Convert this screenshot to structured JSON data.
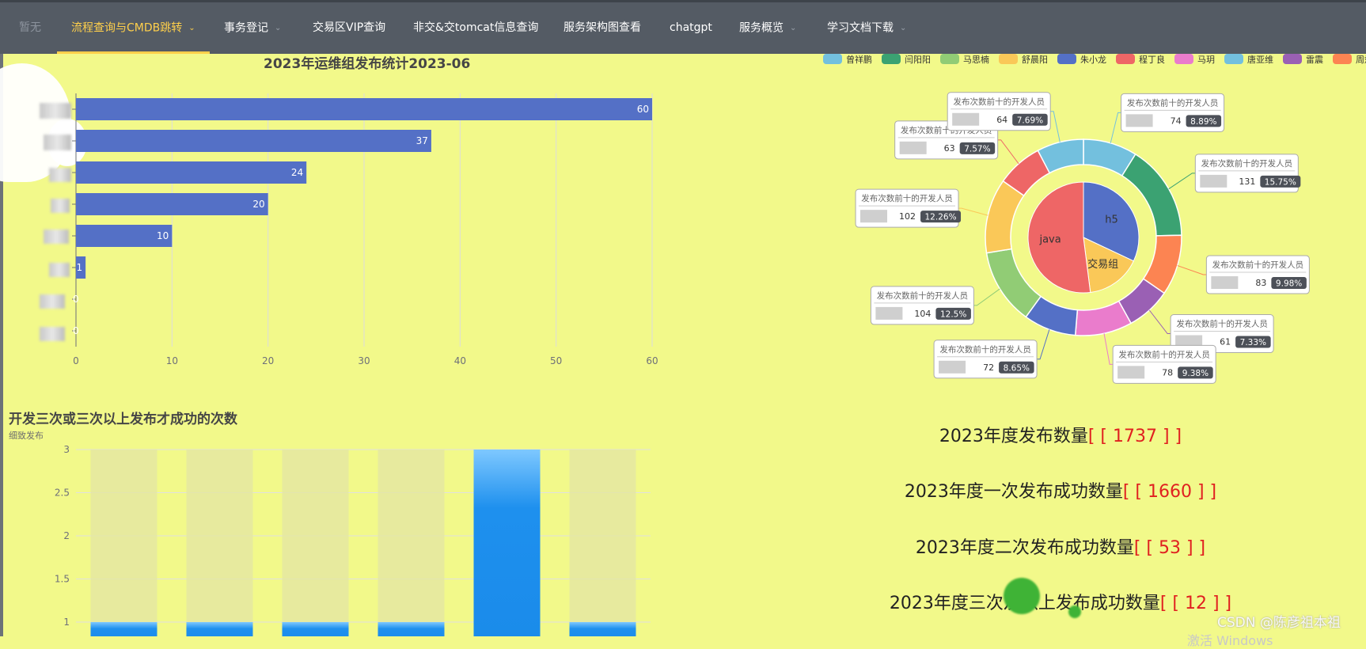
{
  "nav": {
    "items": [
      {
        "label": "暂无",
        "dropdown": false,
        "state": "disabled"
      },
      {
        "label": "流程查询与CMDB跳转",
        "dropdown": true,
        "state": "active"
      },
      {
        "label": "事务登记",
        "dropdown": true,
        "state": "normal"
      },
      {
        "label": "交易区VIP查询",
        "dropdown": false,
        "state": "normal"
      },
      {
        "label": "非交&交tomcat信息查询",
        "dropdown": false,
        "state": "normal"
      },
      {
        "label": "服务架构图查看",
        "dropdown": false,
        "state": "normal"
      },
      {
        "label": "chatgpt",
        "dropdown": false,
        "state": "normal"
      },
      {
        "label": "服务概览",
        "dropdown": true,
        "state": "normal"
      },
      {
        "label": "学习文档下载",
        "dropdown": true,
        "state": "normal"
      }
    ],
    "colors": {
      "background": "#545b64",
      "active": "#ffd04b",
      "text": "#ffffff",
      "disabled": "#8c939d"
    }
  },
  "chart_data": [
    {
      "type": "bar",
      "orientation": "horizontal",
      "title": "2023年运维组发布统计2023-06",
      "values": [
        60,
        37,
        24,
        20,
        10,
        1,
        0,
        0
      ],
      "value_labels": [
        "60",
        "37",
        "24",
        "20",
        "10",
        "1",
        "0",
        "0"
      ],
      "xlim": [
        0,
        60
      ],
      "x_ticks": [
        "0",
        "10",
        "20",
        "30",
        "40",
        "50",
        "60"
      ],
      "category_labels_obscured": true,
      "grid": true,
      "color": "#5470c6"
    },
    {
      "type": "pie",
      "variant": "nested-donut",
      "legend": [
        "曾祥鹏",
        "闫阳阳",
        "马思楠",
        "舒晨阳",
        "朱小龙",
        "程丁良",
        "马玥",
        "唐亚维",
        "雷震",
        "周斌"
      ],
      "legend_colors": [
        "#73c0de",
        "#3ba272",
        "#91cc75",
        "#fac858",
        "#5470c6",
        "#ee6666",
        "#ea7ccc",
        "#73c0de",
        "#9a60b4",
        "#fc8452"
      ],
      "legend_position": "top-right",
      "inner": {
        "labels": [
          "h5",
          "交易组",
          "java"
        ],
        "values": [
          32,
          16,
          52
        ],
        "colors": [
          "#5470c6",
          "#fac858",
          "#ee6666"
        ]
      },
      "outer": {
        "label_title": "发布次数前十的开发人员",
        "values": [
          74,
          131,
          83,
          61,
          78,
          72,
          104,
          102,
          63,
          64
        ],
        "percents": [
          "8.89%",
          "15.75%",
          "9.98%",
          "7.33%",
          "9.38%",
          "8.65%",
          "12.5%",
          "12.26%",
          "7.57%",
          "7.69%"
        ],
        "colors": [
          "#73c0de",
          "#3ba272",
          "#fc8452",
          "#9a60b4",
          "#ea7ccc",
          "#5470c6",
          "#91cc75",
          "#fac858",
          "#ee6666",
          "#73c0de"
        ]
      }
    },
    {
      "type": "bar",
      "title": "开发三次或三次以上发布才成功的次数",
      "subtitle": "细致发布",
      "values": [
        1,
        1,
        1,
        1,
        3,
        1
      ],
      "ylim": [
        1,
        3
      ],
      "y_ticks": [
        "1",
        "1.5",
        "2",
        "2.5",
        "3"
      ],
      "highlight_index": 4,
      "grid": true,
      "color": "#1e90ee"
    }
  ],
  "stats": [
    {
      "label": "2023年度发布数量",
      "value": "[ [ 1737 ] ]"
    },
    {
      "label": "2023年度一次发布成功数量",
      "value": "[ [ 1660 ] ]"
    },
    {
      "label": "2023年度二次发布成功数量",
      "value": "[ [ 53 ] ]"
    },
    {
      "label": "2023年度三次及以上发布成功数量",
      "value": "[ [ 12 ] ]"
    }
  ],
  "watermark": "CSDN @陈彦祖本祖",
  "os_overlay": "激活 Windows"
}
